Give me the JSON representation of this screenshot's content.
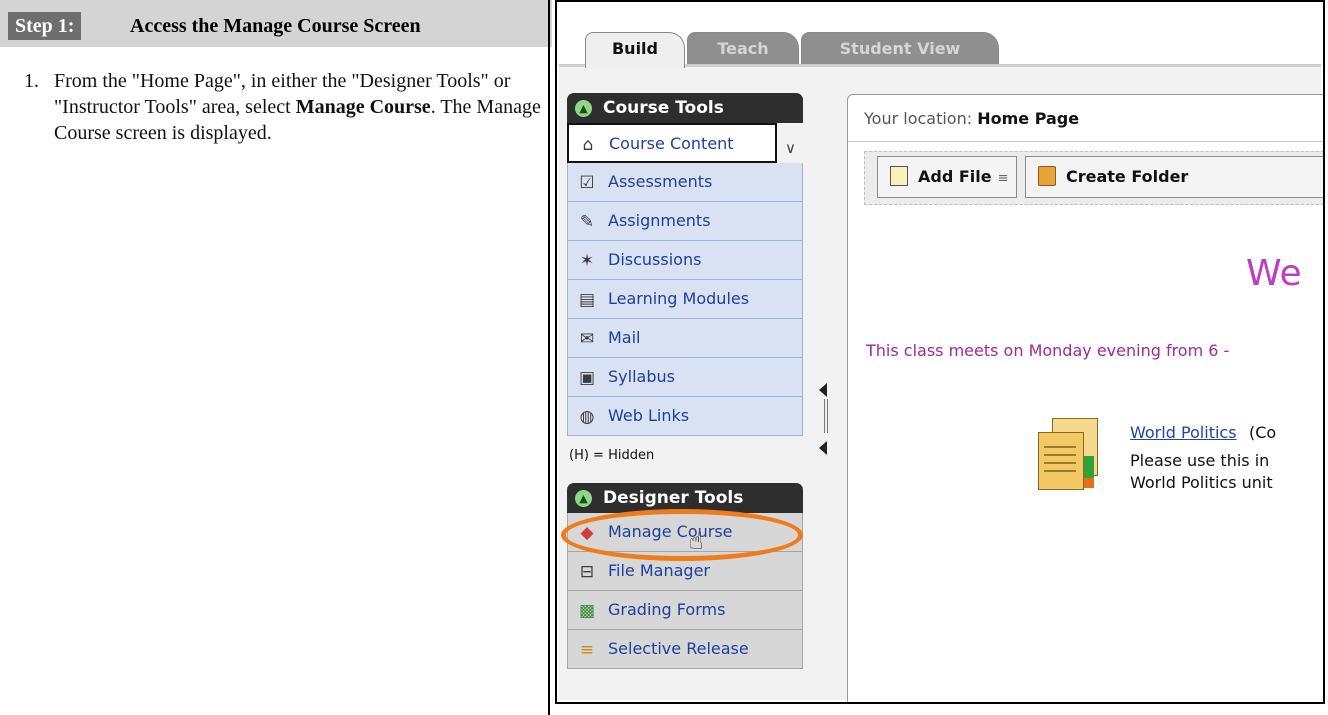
{
  "step": {
    "label": "Step 1:",
    "title": "Access the Manage Course Screen"
  },
  "instructions": [
    {
      "number": "1.",
      "text_before": "From the \"Home Page\", in either the \"Designer Tools\" or \"Instructor Tools\" area, select ",
      "bold": "Manage Course",
      "text_after": ". The Manage Course screen is displayed."
    }
  ],
  "tabs": [
    {
      "label": "Build"
    },
    {
      "label": "Teach"
    },
    {
      "label": "Student View"
    }
  ],
  "course_tools": {
    "title": "Course Tools",
    "items": [
      {
        "label": "Course Content",
        "icon": "home-icon"
      },
      {
        "label": "Assessments",
        "icon": "assessment-icon"
      },
      {
        "label": "Assignments",
        "icon": "assignment-icon"
      },
      {
        "label": "Discussions",
        "icon": "pushpin-icon"
      },
      {
        "label": "Learning Modules",
        "icon": "module-icon"
      },
      {
        "label": "Mail",
        "icon": "mail-icon"
      },
      {
        "label": "Syllabus",
        "icon": "syllabus-icon"
      },
      {
        "label": "Web Links",
        "icon": "globe-icon"
      }
    ],
    "hidden_note": "(H) = Hidden"
  },
  "designer_tools": {
    "title": "Designer Tools",
    "items": [
      {
        "label": "Manage Course",
        "icon": "manage-course-icon"
      },
      {
        "label": "File Manager",
        "icon": "file-manager-icon"
      },
      {
        "label": "Grading Forms",
        "icon": "grading-forms-icon"
      },
      {
        "label": "Selective Release",
        "icon": "selective-release-icon"
      }
    ]
  },
  "content": {
    "location_prefix": "Your location:",
    "location": "Home Page",
    "add_file_label": "Add File",
    "create_folder_label": "Create Folder",
    "welcome_partial": "We",
    "class_info": "This class meets on Monday evening from 6 -",
    "item_link": "World Politics",
    "item_link_tail": "(Co",
    "item_desc_line1": "Please use this in",
    "item_desc_line2": "World Politics unit"
  },
  "colors": {
    "highlight_ring": "#f07b1a",
    "nav_link": "#1d3f9e",
    "welcome": "#c03cc0"
  }
}
